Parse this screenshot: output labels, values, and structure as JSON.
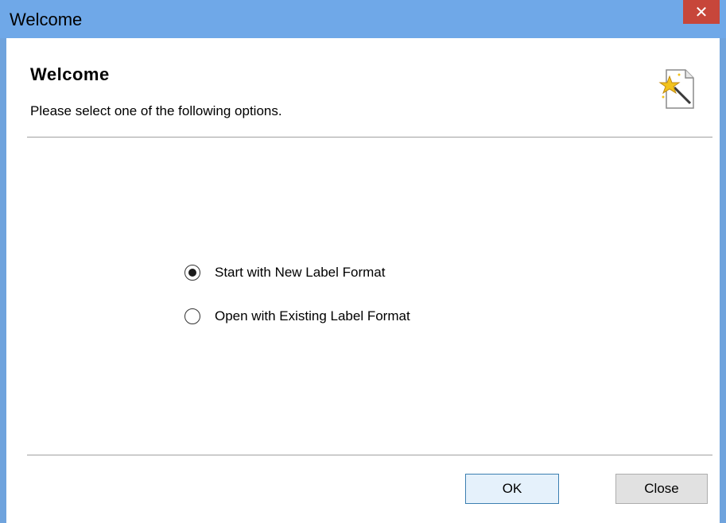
{
  "window": {
    "title": "Welcome",
    "close_glyph": "✕"
  },
  "header": {
    "title": "Welcome",
    "subtitle": "Please select one of the following options.",
    "icon": "wizard-document-icon"
  },
  "options": [
    {
      "label": "Start with New Label Format",
      "checked": true
    },
    {
      "label": "Open with Existing Label Format",
      "checked": false
    }
  ],
  "buttons": {
    "ok_label": "OK",
    "close_label": "Close"
  },
  "colors": {
    "titlebar": "#6fa8e8",
    "close_button": "#c7463a",
    "ok_border": "#3c7fb1"
  }
}
